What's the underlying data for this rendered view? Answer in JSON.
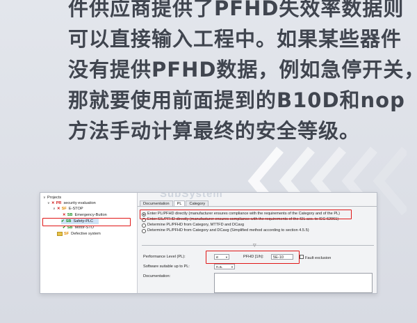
{
  "headline": {
    "lines": [
      "件供应商提供了PFHD失效率数据则",
      "可以直接输入工程中。如果某些器件",
      "没有提供PFHD数据，例如急停开关，",
      "那就要使用前面提到的B10D和nop",
      "方法手动计算最终的安全等级。"
    ]
  },
  "tree": {
    "root": "Projects",
    "project_tag": "PR",
    "project_label": "security evaluation",
    "sf_tag": "SF",
    "sf_label": "E-STOP",
    "sb1_tag": "SB",
    "sb1_label": "Emergency-Button",
    "sb2_tag": "SB",
    "sb2_label": "Safety-PLC",
    "sb3_tag": "SB",
    "sb3_label": "Motor-STO",
    "sf2_tag": "SF",
    "sf2_label": "Defective system"
  },
  "panel": {
    "watermark": "SubSystem",
    "tabs": [
      "Documentation",
      "PL",
      "Category"
    ],
    "options": [
      "Enter PL/PFHD directly (manufacturer ensures compliance with the requirements of the Category and of the PL)",
      "Enter SIL/PFHD directly (manufacturer ensures compliance with the requirements of the SIL acc. to IEC 62061)",
      "Determine PL/PFHD from Category, MTTFD and DCavg",
      "Determine PL/PFHD from Category and DCavg (Simplified method according to section 4.5.5)"
    ],
    "pl_label": "Performance Level (PL):",
    "pl_value": "e",
    "pfhd_label": "PFHD [1/h]:",
    "pfhd_value": "5E-10",
    "fault_exclusion": "Fault exclusion",
    "software_label": "Software suitable up to PL:",
    "software_value": "n.a.",
    "documentation_label": "Documentation:"
  },
  "colors": {
    "headline": "#40454f",
    "highlight_red": "#e01616",
    "status_red": "#d01a1a",
    "status_green": "#1c8f24",
    "status_orange": "#e08a00"
  }
}
